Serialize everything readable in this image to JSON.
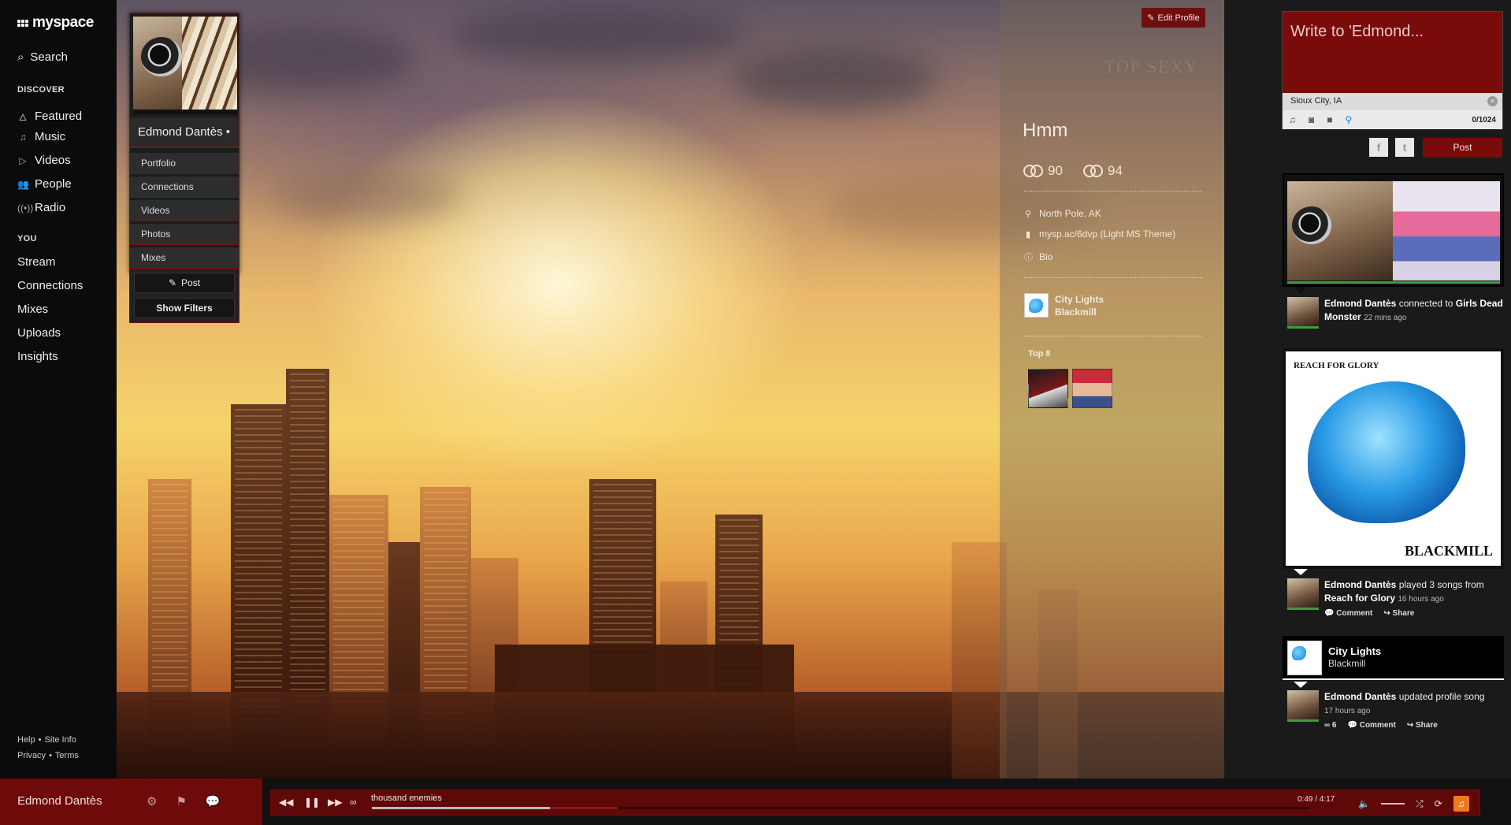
{
  "nav": {
    "logo": "myspace",
    "search": "Search",
    "discover_label": "DISCOVER",
    "discover_items": [
      "Featured",
      "Music",
      "Videos",
      "People",
      "Radio"
    ],
    "you_label": "YOU",
    "you_items": [
      "Stream",
      "Connections",
      "Mixes",
      "Uploads",
      "Insights"
    ],
    "footer": {
      "help": "Help",
      "site_info": "Site Info",
      "privacy": "Privacy",
      "terms": "Terms"
    }
  },
  "profile_card": {
    "name": "Edmond Dantès •",
    "links": [
      "Portfolio",
      "Connections",
      "Videos",
      "Photos",
      "Mixes"
    ],
    "post_label": "Post",
    "filters_label": "Show Filters"
  },
  "info": {
    "edit_profile": "Edit Profile",
    "watermark": "TOP SEXY",
    "headline": "Hmm",
    "connections_in": "90",
    "connections_out": "94",
    "location": "North Pole, AK",
    "link": "mysp.ac/6dvp (Light MS Theme)",
    "bio": "Bio",
    "song_title": "City Lights",
    "song_artist": "Blackmill",
    "top8_label": "Top 8"
  },
  "composer": {
    "placeholder": "Write to 'Edmond...",
    "location": "Sioux City, IA",
    "char_count": "0/1024",
    "post_label": "Post",
    "facebook": "f",
    "twitter": "t"
  },
  "feed": [
    {
      "user": "Edmond Dantès",
      "action": "connected to",
      "target": "Girls Dead Monster",
      "time": "22 mins ago"
    },
    {
      "image_title": "REACH FOR GLORY",
      "image_caption": "BLACKMILL",
      "user": "Edmond Dantès",
      "action": "played 3 songs from",
      "target": "Reach for Glory",
      "time": "16 hours ago",
      "comment": "Comment",
      "share": "Share"
    },
    {
      "song_title": "City Lights",
      "song_artist": "Blackmill",
      "user": "Edmond Dantès",
      "action": "updated profile song",
      "time": "17 hours ago",
      "connects": "6",
      "comment": "Comment",
      "share": "Share"
    }
  ],
  "bottombar": {
    "user": "Edmond Dantès",
    "track": "thousand enemies",
    "time": "0:49 / 4:17",
    "progress": 0.19
  },
  "colors": {
    "accent": "#7a0b0b",
    "player": "#5e0808",
    "orange": "#ef7a1e"
  }
}
